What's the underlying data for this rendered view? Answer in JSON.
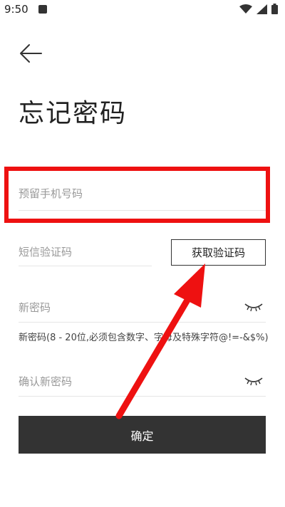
{
  "status_bar": {
    "time": "9:50"
  },
  "page": {
    "title": "忘记密码"
  },
  "form": {
    "phone_placeholder": "预留手机号码",
    "sms_placeholder": "短信验证码",
    "get_code_label": "获取验证码",
    "new_password_placeholder": "新密码",
    "password_hint": "新密码(8 - 20位,必须包含数字、字母及特殊字符@!=-&$%)",
    "confirm_password_placeholder": "确认新密码",
    "submit_label": "确定"
  },
  "colors": {
    "accent_red": "#ee1111",
    "button_dark": "#333333"
  },
  "icons": [
    "back-arrow-icon",
    "eye-closed-icon",
    "wifi-icon",
    "signal-icon",
    "battery-icon"
  ]
}
